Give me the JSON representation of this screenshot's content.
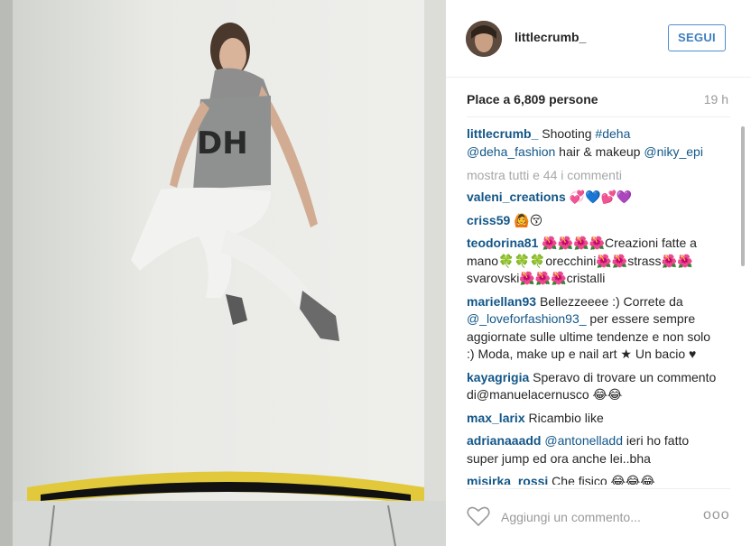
{
  "post": {
    "username": "littlecrumb_",
    "follow_label": "SEGUI",
    "likes_text": "Place a 6,809 persone",
    "time_ago": "19 h",
    "show_all": "mostra tutti e 44 i commenti",
    "comment_placeholder": "Aggiungi un commento...",
    "more_options": "ooo"
  },
  "caption": {
    "user": "littlecrumb_",
    "text_1": " Shooting ",
    "hashtag": "#deha",
    "mention_1": "@deha_fashion",
    "text_2": " hair & makeup ",
    "mention_2": "@niky_epi"
  },
  "comments": [
    {
      "user": "valeni_creations",
      "text": " 💞💙💕💜"
    },
    {
      "user": "criss59",
      "text": " 🙆😚"
    },
    {
      "user": "teodorina81",
      "text": " 🌺🌺🌺🌺Creazioni fatte a mano🍀🍀🍀orecchini🌺🌺strass🌺🌺 svarovski🌺🌺🌺cristalli"
    },
    {
      "user": "mariellan93",
      "text": " Bellezzeeee :) Correte da ",
      "mention": "@_loveforfashion93_",
      "text_after": " per essere sempre aggiornate sulle ultime tendenze e non solo :) Moda, make up e nail art ★ Un bacio ♥"
    },
    {
      "user": "kayagrigia",
      "text": " Speravo di trovare un commento di@manuelacernusco 😂😂"
    },
    {
      "user": "max_larix",
      "text": " Ricambio like"
    },
    {
      "user": "adrianaaadd",
      "text": " ",
      "mention": "@antonelladd",
      "text_after": " ieri ho fatto super jump ed ora anche lei..bha"
    },
    {
      "user": "misirka_rossi",
      "text": " Che fisico 😂😂😂"
    }
  ],
  "icons": {
    "heart": "heart-icon",
    "more": "more-options-icon"
  },
  "colors": {
    "link": "#125688",
    "follow": "#3f7fbf",
    "muted": "#999999"
  }
}
